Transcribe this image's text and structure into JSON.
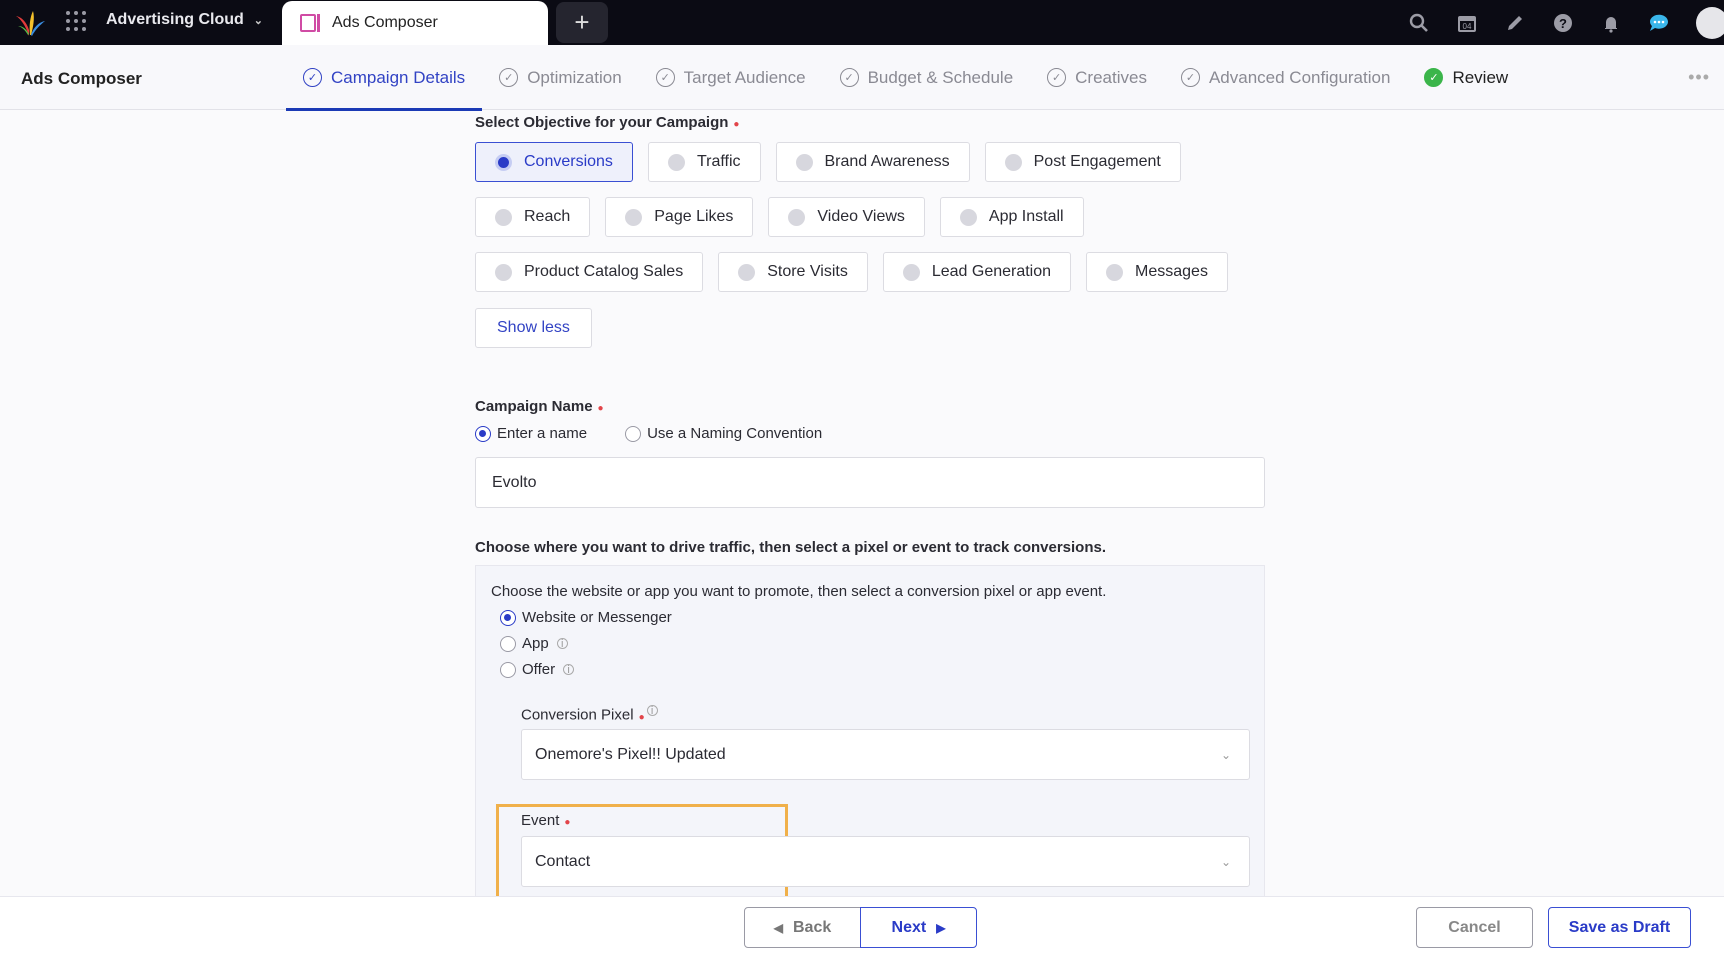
{
  "topbar": {
    "app_name": "Advertising Cloud",
    "active_tab": "Ads Composer",
    "icons": [
      "search-icon",
      "calendar-icon",
      "edit-icon",
      "help-icon",
      "bell-icon",
      "chat-icon",
      "avatar"
    ],
    "calendar_day": "04"
  },
  "subbar": {
    "title": "Ads Composer",
    "steps": [
      {
        "label": "Campaign Details",
        "state": "active"
      },
      {
        "label": "Optimization",
        "state": "pending"
      },
      {
        "label": "Target Audience",
        "state": "pending"
      },
      {
        "label": "Budget & Schedule",
        "state": "pending"
      },
      {
        "label": "Creatives",
        "state": "pending"
      },
      {
        "label": "Advanced Configuration",
        "state": "pending"
      },
      {
        "label": "Review",
        "state": "done"
      }
    ]
  },
  "objective": {
    "label": "Select Objective for your Campaign",
    "rows": [
      [
        "Conversions",
        "Traffic",
        "Brand Awareness",
        "Post Engagement"
      ],
      [
        "Reach",
        "Page Likes",
        "Video Views",
        "App Install"
      ],
      [
        "Product Catalog Sales",
        "Store Visits",
        "Lead Generation",
        "Messages"
      ]
    ],
    "selected": "Conversions",
    "show_less": "Show less"
  },
  "campaign_name": {
    "label": "Campaign Name",
    "options": [
      "Enter a name",
      "Use a Naming Convention"
    ],
    "selected": "Enter a name",
    "value": "Evolto"
  },
  "traffic": {
    "label": "Choose where you want to drive traffic, then select a pixel or event to track conversions.",
    "panel_text": "Choose the website or app you want to promote, then select a conversion pixel or app event.",
    "options": [
      "Website or Messenger",
      "App",
      "Offer"
    ],
    "selected": "Website or Messenger",
    "pixel_label": "Conversion Pixel",
    "pixel_value": "Onemore's Pixel!! Updated",
    "event_label": "Event",
    "event_value": "Contact"
  },
  "footer": {
    "back": "Back",
    "next": "Next",
    "cancel": "Cancel",
    "save_draft": "Save as Draft"
  },
  "colors": {
    "accent": "#2a3bc7",
    "highlight": "#f0b04a",
    "success": "#3bb54a"
  }
}
